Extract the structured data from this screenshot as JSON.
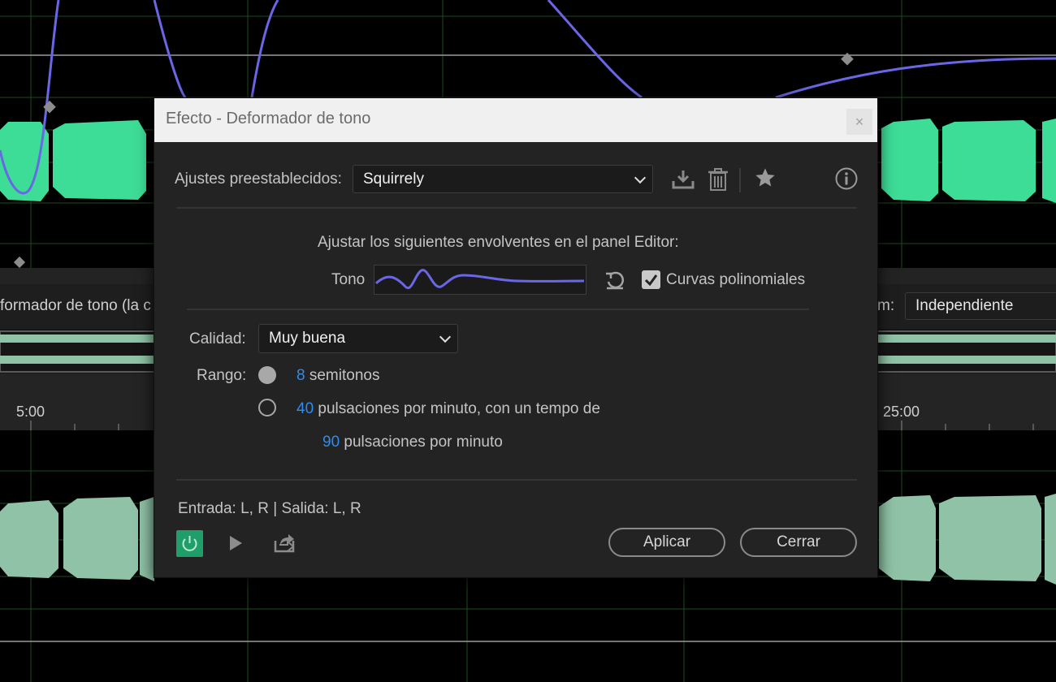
{
  "background": {
    "effect_label": "formador de tono (la c",
    "mode_label": "m:",
    "mode_value": "Independiente",
    "time_left": "5:00",
    "time_right": "25:00"
  },
  "dialog": {
    "title": "Efecto - Deformador de tono",
    "close": "×",
    "presets_label": "Ajustes preestablecidos:",
    "preset_value": "Squirrely",
    "envelope_instruction": "Ajustar los siguientes envolventes en el panel Editor:",
    "pitch_label": "Tono",
    "polynomial_label": "Curvas polinomiales",
    "polynomial_checked": true,
    "quality_label": "Calidad:",
    "quality_value": "Muy buena",
    "range_label": "Rango:",
    "range_option1_value": "8",
    "range_option1_text": "semitonos",
    "range_option2_value": "40",
    "range_option2_text": "pulsaciones por minuto, con un tempo de",
    "tempo_value": "90",
    "tempo_text": "pulsaciones por minuto",
    "io_label": "Entrada: L, R | Salida: L, R",
    "apply_button": "Aplicar",
    "close_button": "Cerrar"
  },
  "icons": [
    "download-preset-icon",
    "delete-preset-icon",
    "favorite-star-icon",
    "info-icon",
    "reset-icon",
    "power-icon",
    "play-icon",
    "export-icon",
    "chevron-down-icon"
  ],
  "colors": {
    "accent_blue": "#2f8cf0",
    "waveform_green": "#3ddc97",
    "waveform_pale": "#8fc2a6",
    "envelope_purple": "#6b66e6",
    "power_green": "#1f9e6a"
  }
}
